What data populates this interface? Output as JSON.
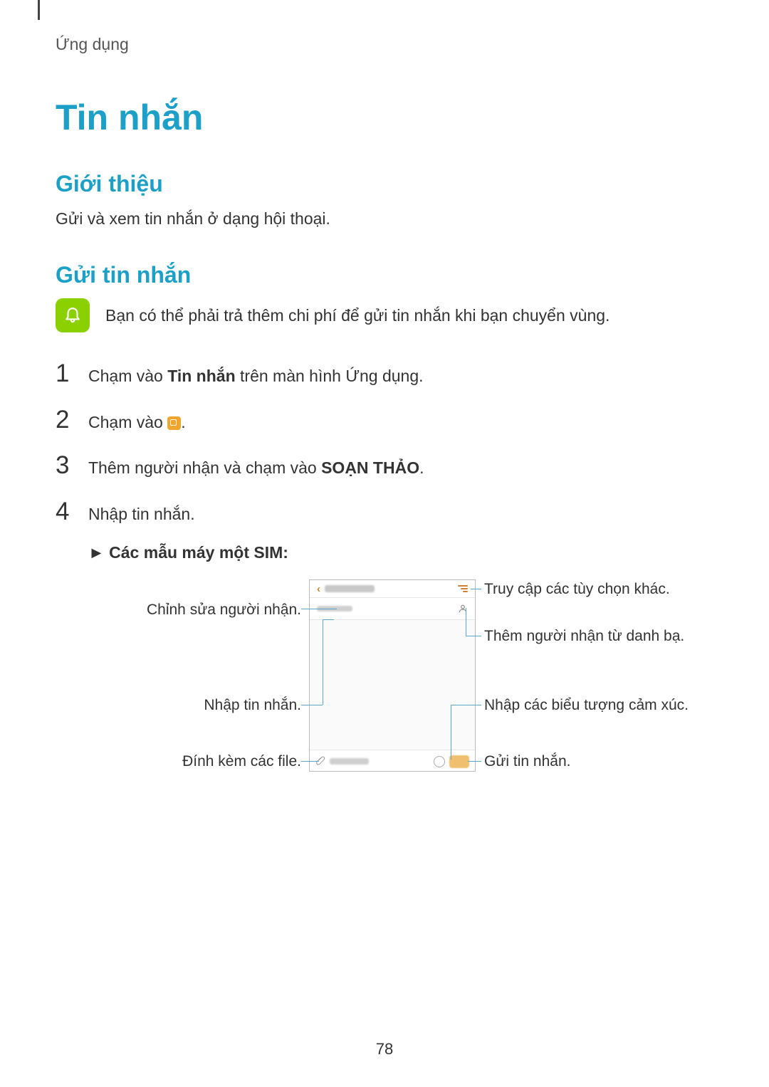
{
  "breadcrumb": "Ứng dụng",
  "title": "Tin nhắn",
  "sections": {
    "intro": {
      "heading": "Giới thiệu",
      "body": "Gửi và xem tin nhắn ở dạng hội thoại."
    },
    "send": {
      "heading": "Gửi tin nhắn",
      "note": "Bạn có thể phải trả thêm chi phí để gửi tin nhắn khi bạn chuyển vùng.",
      "steps": [
        {
          "num": "1",
          "pre": "Chạm vào ",
          "bold": "Tin nhắn",
          "post": " trên màn hình Ứng dụng."
        },
        {
          "num": "2",
          "pre": "Chạm vào ",
          "icon": "compose",
          "post": "."
        },
        {
          "num": "3",
          "pre": "Thêm người nhận và chạm vào ",
          "bold": "SOẠN THẢO",
          "post": "."
        },
        {
          "num": "4",
          "pre": "Nhập tin nhắn.",
          "bold": "",
          "post": ""
        }
      ],
      "sub_bullet": "► Các mẫu máy một SIM:"
    }
  },
  "callouts": {
    "left": {
      "edit_recipient": "Chỉnh sửa người nhận.",
      "enter_msg": "Nhập tin nhắn.",
      "attach": "Đính kèm các file."
    },
    "right": {
      "more_options": "Truy cập các tùy chọn khác.",
      "add_contact": "Thêm người nhận từ danh bạ.",
      "enter_emoji": "Nhập các biểu tượng cảm xúc.",
      "send": "Gửi tin nhắn."
    }
  },
  "page_number": "78"
}
